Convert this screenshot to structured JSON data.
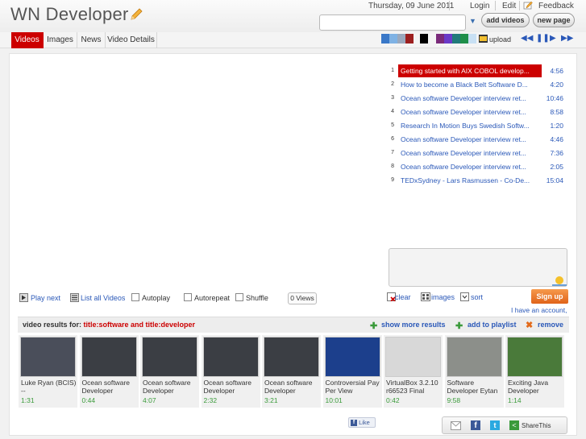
{
  "header": {
    "logo": "WN Developer",
    "date": "Thursday, 09 June 2011",
    "login": "Login",
    "edit": "Edit",
    "feedback": "Feedback",
    "search_value": "",
    "add_videos": "add videos",
    "new_page": "new page"
  },
  "tabs": [
    "Videos",
    "Images",
    "News",
    "Video Details"
  ],
  "toolbar": {
    "upload": "upload",
    "swatches": [
      "#3a78c8",
      "#7fb2e4",
      "#9aa8bd",
      "#9c1f1f",
      "#000000",
      "#7a2a7a",
      "#6a3ac8",
      "#217a7a",
      "#1f8f4a",
      "#c8e0f4"
    ]
  },
  "playlist": [
    {
      "num": "1",
      "title": "Getting started with AIX COBOL develop...",
      "dur": "4:56"
    },
    {
      "num": "2",
      "title": "How to become a Black Belt Software D...",
      "dur": "4:20"
    },
    {
      "num": "3",
      "title": "Ocean software Developer interview ret...",
      "dur": "10:46"
    },
    {
      "num": "4",
      "title": "Ocean software Developer interview ret...",
      "dur": "8:58"
    },
    {
      "num": "5",
      "title": "Research In Motion Buys Swedish Softw...",
      "dur": "1:20"
    },
    {
      "num": "6",
      "title": "Ocean software Developer interview ret...",
      "dur": "4:46"
    },
    {
      "num": "7",
      "title": "Ocean software Developer interview ret...",
      "dur": "7:36"
    },
    {
      "num": "8",
      "title": "Ocean software Developer interview ret...",
      "dur": "2:05"
    },
    {
      "num": "9",
      "title": "TEDxSydney - Lars Rasmussen - Co-De...",
      "dur": "15:04"
    }
  ],
  "controls": {
    "play_next": "Play next",
    "list_all": "List all Videos",
    "autoplay": "Autoplay",
    "autorepeat": "Autorepeat",
    "shuffle": "Shuffle",
    "views": "0 Views",
    "clear": "clear",
    "images": "images",
    "sort": "sort",
    "signup": "Sign up",
    "have_account": "I have an account, lo"
  },
  "results": {
    "prefix": "video results for:",
    "query": "title:software and title:developer",
    "show_more": "show more results",
    "add_playlist": "add to playlist",
    "remove": "remove",
    "items": [
      {
        "title": "Luke Ryan (BCIS) --",
        "dur": "1:31",
        "color": "#4a4e5a"
      },
      {
        "title": "Ocean software Developer",
        "dur": "0:44",
        "color": "#3b3e44"
      },
      {
        "title": "Ocean software Developer",
        "dur": "4:07",
        "color": "#3b3e44"
      },
      {
        "title": "Ocean software Developer",
        "dur": "2:32",
        "color": "#3b3e44"
      },
      {
        "title": "Ocean software Developer",
        "dur": "3:21",
        "color": "#3b3e44"
      },
      {
        "title": "Controversial Pay Per View",
        "dur": "10:01",
        "color": "#1c3f8c"
      },
      {
        "title": "VirtualBox 3.2.10 r66523 Final",
        "dur": "0:42",
        "color": "#d8d8d8"
      },
      {
        "title": "Software Developer Eytan",
        "dur": "9:58",
        "color": "#8c8f8a"
      },
      {
        "title": "Exciting Java Developer",
        "dur": "1:14",
        "color": "#4a7a3a"
      }
    ]
  },
  "footer": {
    "like": "Like",
    "share": "ShareThis"
  }
}
